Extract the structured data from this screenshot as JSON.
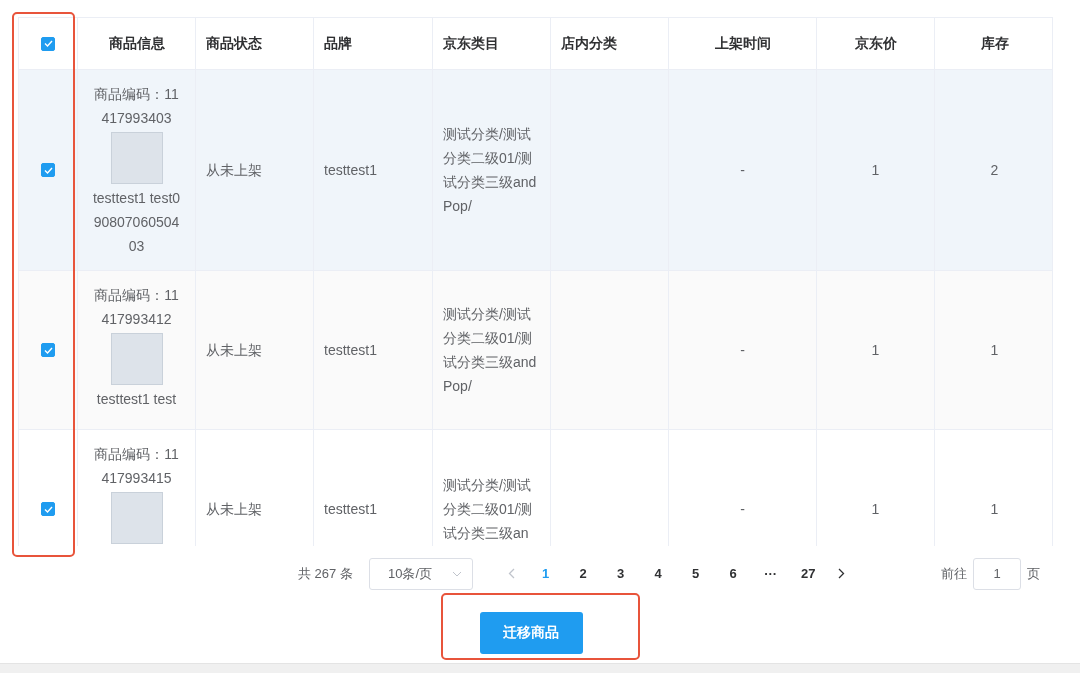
{
  "select_all": {
    "checked": true
  },
  "columns": [
    "商品信息",
    "商品状态",
    "品牌",
    "京东类目",
    "店内分类",
    "上架时间",
    "京东价",
    "库存"
  ],
  "rows": [
    {
      "checked": true,
      "hovered": true,
      "product_code": "商品编码：11417993403",
      "product_name": "testtest1 test09080706050403",
      "status": "从未上架",
      "brand": "testtest1",
      "category": "测试分类/测试分类二级01/测试分类三级andPop/",
      "listed_time": "-",
      "price": "1",
      "stock": "2"
    },
    {
      "checked": true,
      "hovered": false,
      "product_code": "商品编码：11417993412",
      "product_name": "testtest1 test",
      "status": "从未上架",
      "brand": "testtest1",
      "category": "测试分类/测试分类二级01/测试分类三级andPop/",
      "listed_time": "-",
      "price": "1",
      "stock": "1"
    },
    {
      "checked": true,
      "hovered": false,
      "product_code": "商品编码：11417993415",
      "status": "从未上架",
      "brand": "testtest1",
      "category": "测试分类/测试分类二级01/测试分类三级an",
      "listed_time": "-",
      "price": "1",
      "stock": "1"
    }
  ],
  "pagination": {
    "total": "共 267 条",
    "page_size": "10条/页",
    "pages": [
      {
        "label": "1",
        "selected": true
      },
      {
        "label": "2",
        "selected": false
      },
      {
        "label": "3",
        "selected": false
      },
      {
        "label": "4",
        "selected": false
      },
      {
        "label": "5",
        "selected": false
      },
      {
        "label": "6",
        "selected": false
      },
      {
        "label": "···",
        "selected": false
      },
      {
        "label": "27",
        "selected": false
      }
    ],
    "goto_label": "前往",
    "goto_value": "1",
    "goto_suffix": "页"
  },
  "migrate_button": "迁移商品",
  "highlight_checkbox_column": true,
  "highlight_migrate_button": true
}
